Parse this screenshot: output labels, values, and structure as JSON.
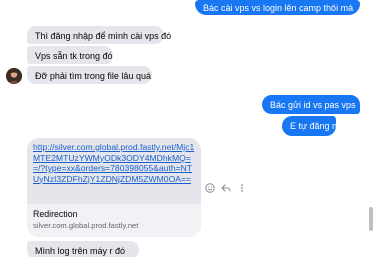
{
  "messages": {
    "out1": "Bác cài vps vs login lên camp thôi mà",
    "in1": "Thì đăng nhập để mình cài vps đó",
    "in2": "Vps sẵn tk trong đó",
    "in3": "Đỡ phải tìm trong file lâu quá",
    "out2": "Bác gửi id vs pas vps",
    "out3": "E tự đăng nhập",
    "in4": "Mình log trên máy r đó"
  },
  "link_preview": {
    "url": "http://silver.com.global.prod.fastly.net/Mjc1MTE2MTUzYWMyODk3ODY4MDhkMQ==/?type=xx&orders=780398055&auth=NTUyNzI3ZDFhZjY1ZDNjZDM5ZWM0OA==",
    "title": "Redirection",
    "domain": "silver.com.global.prod.fastly.net"
  },
  "icons": {
    "avatar": "contact-avatar",
    "react": "smiley-face-icon",
    "reply": "reply-arrow-icon",
    "more": "more-dots-icon"
  },
  "colors": {
    "outgoing_bubble": "#1877f2",
    "incoming_bubble": "#e4e6eb",
    "link": "#1a5fd0"
  }
}
